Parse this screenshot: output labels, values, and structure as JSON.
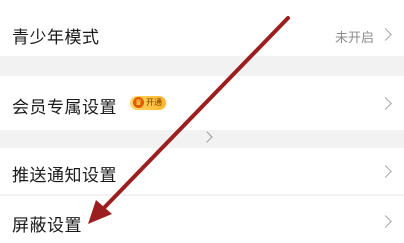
{
  "settings": {
    "youth_mode": {
      "label": "青少年模式",
      "status": "未开启"
    },
    "member_settings": {
      "label": "会员专属设置",
      "badge": "开通"
    },
    "push_notifications": {
      "label": "推送通知设置"
    },
    "block_settings": {
      "label": "屏蔽设置"
    }
  },
  "annotation": {
    "arrow_color": "#9c1f1f",
    "icon": "annotation-arrow"
  },
  "colors": {
    "background": "#f2f2f2",
    "row_background": "#ffffff",
    "badge_gradient": "#ffb52a"
  }
}
